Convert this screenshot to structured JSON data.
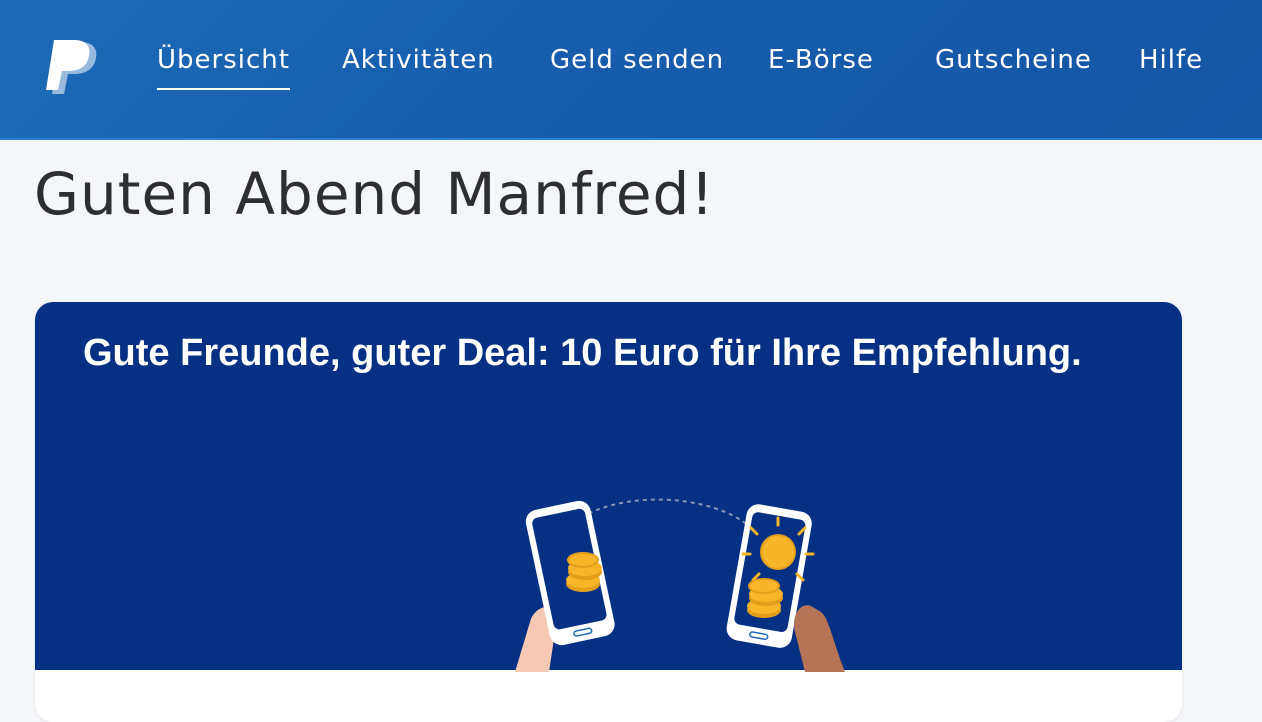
{
  "header": {
    "logo": "paypal-logo",
    "nav": [
      {
        "label": "Übersicht",
        "active": true
      },
      {
        "label": "Aktivitäten",
        "active": false
      },
      {
        "label": "Geld senden",
        "active": false
      },
      {
        "label": "E-Börse",
        "active": false
      },
      {
        "label": "Gutscheine",
        "active": false
      },
      {
        "label": "Hilfe",
        "active": false
      }
    ]
  },
  "main": {
    "greeting": "Guten Abend Manfred!",
    "promo_card": {
      "title": "Gute Freunde, guter Deal: 10 Euro für Ihre Empfehlung.",
      "illustration": "two-phones-sending-coins"
    }
  },
  "colors": {
    "header_blue": "#1c6bb7",
    "banner_navy": "#053084",
    "page_background": "#f5f6fa",
    "coin_gold": "#f7b529"
  }
}
